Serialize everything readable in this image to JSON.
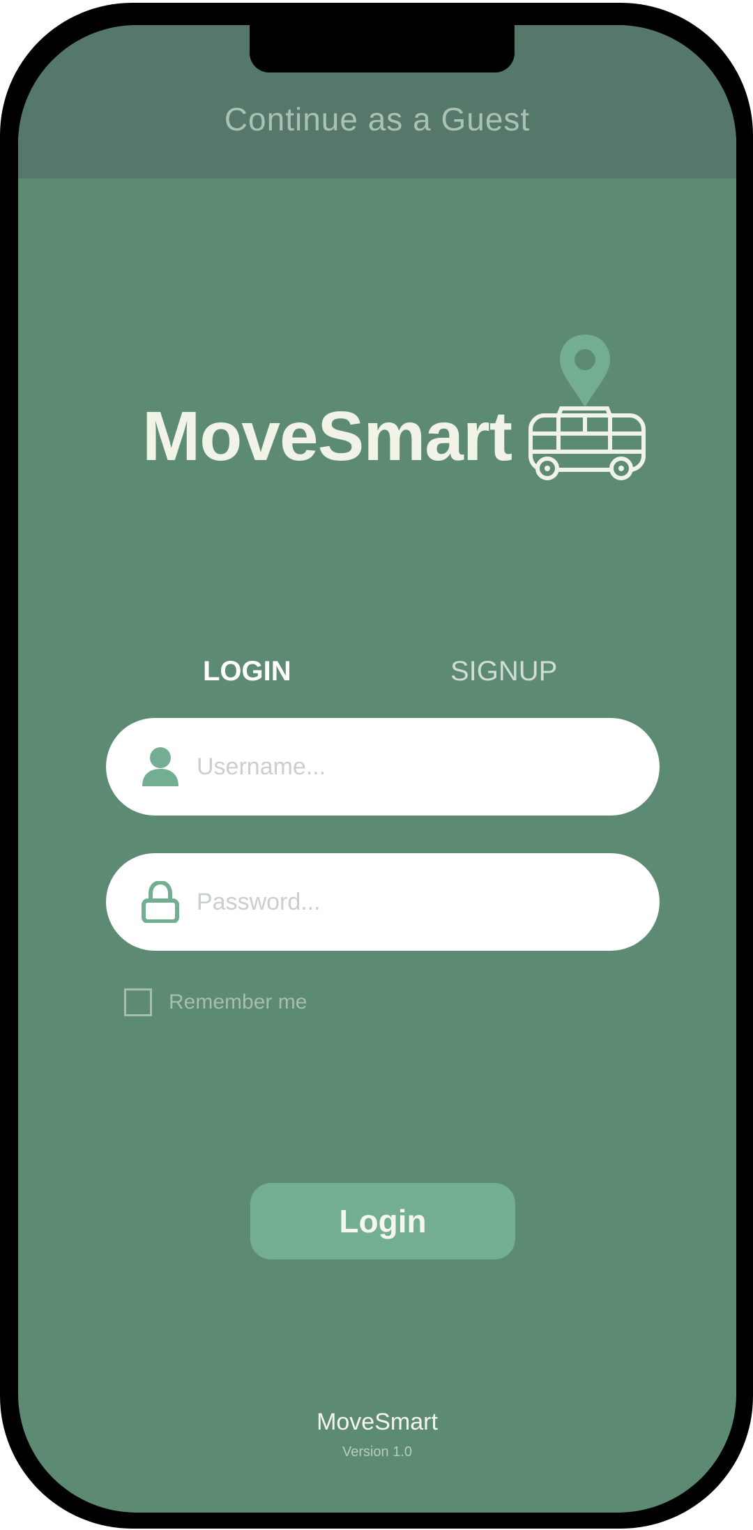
{
  "header": {
    "guest_link": "Continue as a Guest"
  },
  "logo": {
    "name": "MoveSmart",
    "icon": "bus-location-icon"
  },
  "tabs": [
    {
      "label": "LOGIN",
      "active": true
    },
    {
      "label": "SIGNUP",
      "active": false
    }
  ],
  "form": {
    "username": {
      "placeholder": "Username...",
      "value": "",
      "icon": "user-icon"
    },
    "password": {
      "placeholder": "Password...",
      "value": "",
      "icon": "lock-icon"
    },
    "remember_me": {
      "label": "Remember me",
      "checked": false
    },
    "submit_label": "Login"
  },
  "footer": {
    "app_name": "MoveSmart",
    "version": "Version 1.0"
  },
  "colors": {
    "background": "#5d8a72",
    "header": "#55786b",
    "accent": "#73ae93",
    "logo_text": "#f1f3e6"
  }
}
